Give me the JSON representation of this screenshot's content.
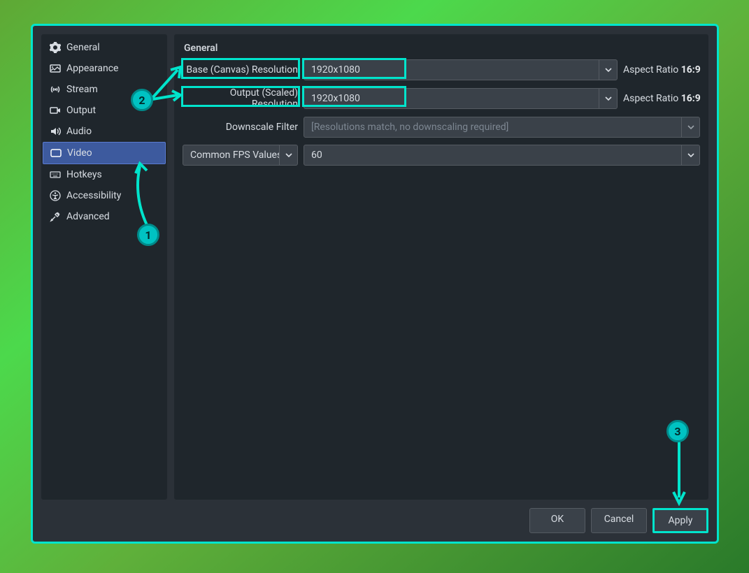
{
  "sidebar": {
    "items": [
      {
        "label": "General"
      },
      {
        "label": "Appearance"
      },
      {
        "label": "Stream"
      },
      {
        "label": "Output"
      },
      {
        "label": "Audio"
      },
      {
        "label": "Video"
      },
      {
        "label": "Hotkeys"
      },
      {
        "label": "Accessibility"
      },
      {
        "label": "Advanced"
      }
    ]
  },
  "main": {
    "section_title": "General",
    "base_label": "Base (Canvas) Resolution",
    "base_value": "1920x1080",
    "base_aspect_label": "Aspect Ratio",
    "base_aspect_value": "16:9",
    "output_label": "Output (Scaled) Resolution",
    "output_value": "1920x1080",
    "output_aspect_label": "Aspect Ratio",
    "output_aspect_value": "16:9",
    "downscale_label": "Downscale Filter",
    "downscale_value": "[Resolutions match, no downscaling required]",
    "fps_type_label": "Common FPS Values",
    "fps_value": "60"
  },
  "footer": {
    "ok": "OK",
    "cancel": "Cancel",
    "apply": "Apply"
  },
  "annotations": {
    "n1": "1",
    "n2": "2",
    "n3": "3"
  }
}
